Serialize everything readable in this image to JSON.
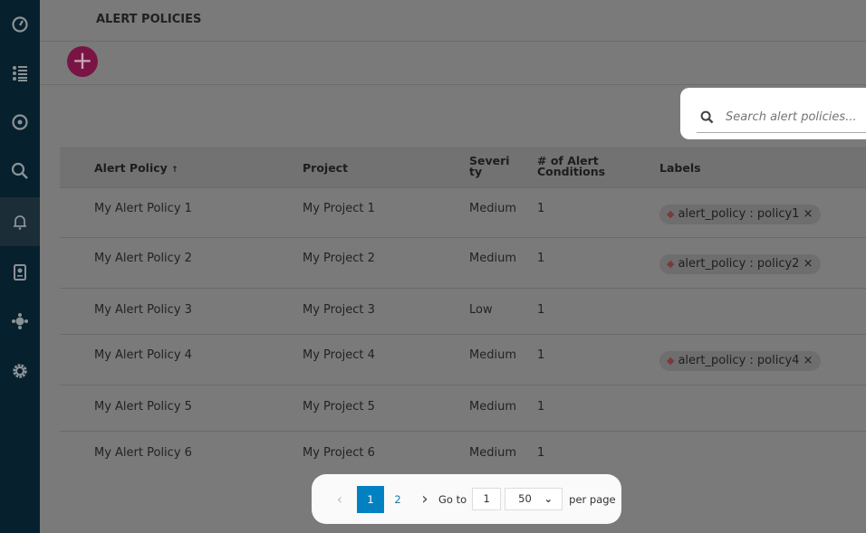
{
  "sidebar": {
    "items": [
      {
        "icon": "speedometer-icon"
      },
      {
        "icon": "list-icon"
      },
      {
        "icon": "target-icon"
      },
      {
        "icon": "analytics-search-icon"
      },
      {
        "icon": "bell-icon",
        "active": true
      },
      {
        "icon": "report-icon"
      },
      {
        "icon": "integration-icon"
      },
      {
        "icon": "gear-icon"
      }
    ]
  },
  "header": {
    "title": "ALERT POLICIES",
    "add_label": "+"
  },
  "search": {
    "placeholder": "Search alert policies..."
  },
  "table": {
    "columns": [
      "Alert Policy",
      "Project",
      "Severity",
      "# of Alert Conditions",
      "Labels"
    ],
    "sort_indicator": "↑",
    "rows": [
      {
        "policy": "My Alert Policy 1",
        "project": "My Project 1",
        "severity": "Medium",
        "conditions": "1",
        "label": "alert_policy : policy1"
      },
      {
        "policy": "My Alert Policy 2",
        "project": "My Project 2",
        "severity": "Medium",
        "conditions": "1",
        "label": "alert_policy : policy2"
      },
      {
        "policy": "My Alert Policy 3",
        "project": "My Project 3",
        "severity": "Low",
        "conditions": "1",
        "label": ""
      },
      {
        "policy": "My Alert Policy 4",
        "project": "My Project 4",
        "severity": "Medium",
        "conditions": "1",
        "label": "alert_policy : policy4"
      },
      {
        "policy": "My Alert Policy 5",
        "project": "My Project 5",
        "severity": "Medium",
        "conditions": "1",
        "label": ""
      },
      {
        "policy": "My Alert Policy 6",
        "project": "My Project 6",
        "severity": "Medium",
        "conditions": "1",
        "label": ""
      }
    ]
  },
  "pagination": {
    "pages": [
      "1",
      "2"
    ],
    "current": "1",
    "goto_label": "Go to",
    "goto_value": "1",
    "per_page_value": "50",
    "per_page_label": "per page"
  }
}
